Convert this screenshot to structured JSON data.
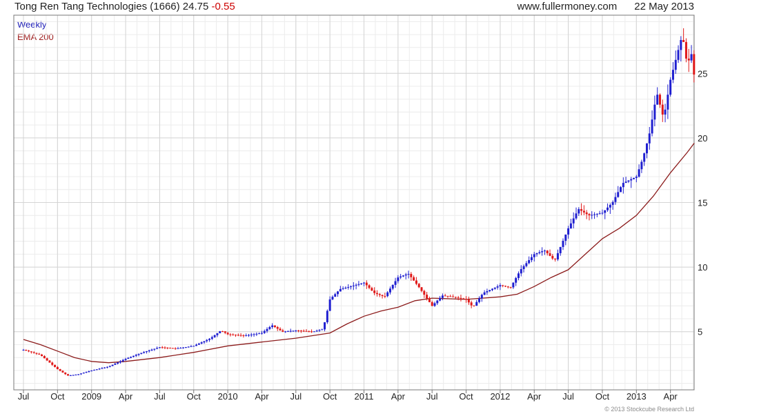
{
  "header": {
    "title": "Tong Ren Tang Technologies (1666)",
    "price": "24.75",
    "change": "-0.55",
    "site": "www.fullermoney.com",
    "date": "22 May 2013"
  },
  "legend": {
    "series1": "Weekly",
    "series2": "EMA 200"
  },
  "footer": {
    "copyright": "© 2013 Stockcube Research Ltd"
  },
  "colors": {
    "up": "#1f1fd0",
    "down": "#e01818",
    "ema": "#8b1a1a",
    "grid": "#d4d4d4"
  },
  "chart_data": {
    "type": "candlestick",
    "ylim": [
      0.5,
      29.5
    ],
    "y_ticks": [
      5,
      10,
      15,
      20,
      25
    ],
    "x_ticks": [
      {
        "label": "Jul",
        "x": 0
      },
      {
        "label": "Oct",
        "x": 1
      },
      {
        "label": "2009",
        "x": 2
      },
      {
        "label": "Apr",
        "x": 3
      },
      {
        "label": "Jul",
        "x": 4
      },
      {
        "label": "Oct",
        "x": 5
      },
      {
        "label": "2010",
        "x": 6
      },
      {
        "label": "Apr",
        "x": 7
      },
      {
        "label": "Jul",
        "x": 8
      },
      {
        "label": "Oct",
        "x": 9
      },
      {
        "label": "2011",
        "x": 10
      },
      {
        "label": "Apr",
        "x": 11
      },
      {
        "label": "Jul",
        "x": 12
      },
      {
        "label": "Oct",
        "x": 13
      },
      {
        "label": "2012",
        "x": 14
      },
      {
        "label": "Apr",
        "x": 15
      },
      {
        "label": "Jul",
        "x": 16
      },
      {
        "label": "Oct",
        "x": 17
      },
      {
        "label": "2013",
        "x": 18
      },
      {
        "label": "Apr",
        "x": 19
      }
    ],
    "close_points": [
      [
        0,
        3.6
      ],
      [
        0.5,
        3.2
      ],
      [
        1,
        2.1
      ],
      [
        1.3,
        1.6
      ],
      [
        1.6,
        1.7
      ],
      [
        2,
        2.0
      ],
      [
        2.5,
        2.3
      ],
      [
        3,
        2.9
      ],
      [
        3.5,
        3.4
      ],
      [
        4,
        3.8
      ],
      [
        4.5,
        3.7
      ],
      [
        5,
        3.9
      ],
      [
        5.5,
        4.5
      ],
      [
        5.8,
        5.1
      ],
      [
        6,
        4.8
      ],
      [
        6.5,
        4.7
      ],
      [
        7,
        4.9
      ],
      [
        7.3,
        5.5
      ],
      [
        7.6,
        5.0
      ],
      [
        8,
        5.1
      ],
      [
        8.5,
        5.0
      ],
      [
        8.8,
        5.2
      ],
      [
        9,
        7.5
      ],
      [
        9.3,
        8.3
      ],
      [
        9.6,
        8.5
      ],
      [
        10,
        8.8
      ],
      [
        10.3,
        8.0
      ],
      [
        10.6,
        7.7
      ],
      [
        11,
        9.2
      ],
      [
        11.3,
        9.5
      ],
      [
        11.6,
        8.5
      ],
      [
        12,
        7.0
      ],
      [
        12.3,
        7.8
      ],
      [
        12.6,
        7.7
      ],
      [
        13,
        7.5
      ],
      [
        13.2,
        6.9
      ],
      [
        13.5,
        8.0
      ],
      [
        14,
        8.6
      ],
      [
        14.3,
        8.4
      ],
      [
        14.6,
        9.8
      ],
      [
        15,
        11.0
      ],
      [
        15.3,
        11.3
      ],
      [
        15.6,
        10.5
      ],
      [
        16,
        13.0
      ],
      [
        16.3,
        14.5
      ],
      [
        16.6,
        14.0
      ],
      [
        17,
        14.2
      ],
      [
        17.3,
        15.0
      ],
      [
        17.6,
        16.5
      ],
      [
        18,
        17.0
      ],
      [
        18.2,
        18.5
      ],
      [
        18.4,
        20.5
      ],
      [
        18.6,
        23.5
      ],
      [
        18.8,
        21.5
      ],
      [
        19,
        24.5
      ],
      [
        19.2,
        26.5
      ],
      [
        19.35,
        28.0
      ],
      [
        19.5,
        25.5
      ],
      [
        19.6,
        26.8
      ],
      [
        19.7,
        24.75
      ]
    ],
    "ema_points": [
      [
        0,
        4.4
      ],
      [
        0.5,
        4.0
      ],
      [
        1,
        3.5
      ],
      [
        1.5,
        3.0
      ],
      [
        2,
        2.7
      ],
      [
        2.5,
        2.6
      ],
      [
        3,
        2.7
      ],
      [
        4,
        3.0
      ],
      [
        5,
        3.4
      ],
      [
        6,
        3.9
      ],
      [
        7,
        4.2
      ],
      [
        8,
        4.5
      ],
      [
        9,
        4.9
      ],
      [
        9.5,
        5.6
      ],
      [
        10,
        6.2
      ],
      [
        10.5,
        6.6
      ],
      [
        11,
        6.9
      ],
      [
        11.5,
        7.4
      ],
      [
        12,
        7.6
      ],
      [
        13,
        7.5
      ],
      [
        14,
        7.7
      ],
      [
        14.5,
        7.9
      ],
      [
        15,
        8.5
      ],
      [
        15.5,
        9.2
      ],
      [
        16,
        9.8
      ],
      [
        16.5,
        11.0
      ],
      [
        17,
        12.2
      ],
      [
        17.5,
        13.0
      ],
      [
        18,
        14.0
      ],
      [
        18.5,
        15.5
      ],
      [
        19,
        17.3
      ],
      [
        19.5,
        18.9
      ],
      [
        19.7,
        19.6
      ]
    ]
  }
}
